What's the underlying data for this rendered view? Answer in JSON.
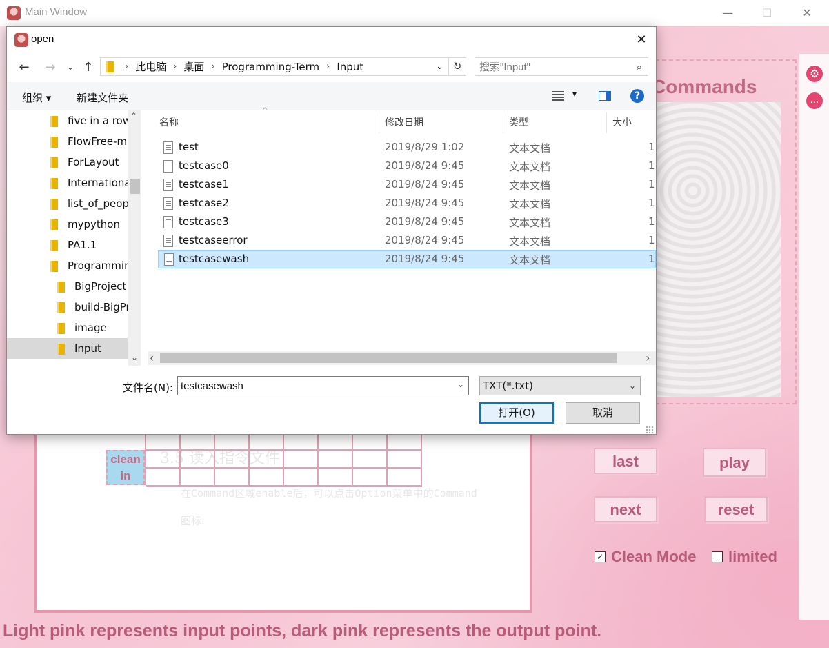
{
  "main_window": {
    "title": "Main Window",
    "controls": {
      "minimize": "—",
      "maximize": "☐",
      "close": "✕"
    },
    "commands_title": "Commands",
    "icons": {
      "settings": "gear-icon",
      "chat": "chat-bubble-icon"
    },
    "buttons": {
      "last": "last",
      "play": "play",
      "next": "next",
      "reset": "reset"
    },
    "checkboxes": [
      {
        "label": "Clean Mode",
        "checked": true,
        "mark": "✓"
      },
      {
        "label": "limited",
        "checked": false,
        "mark": ""
      }
    ],
    "clean_in_label": "clean in",
    "footer_caption": "Light pink represents input points, dark pink represents the output point.",
    "colors": {
      "accent": "#b85c79",
      "border_pink": "#e598ad",
      "clean_in_fill": "#a9d9ee"
    }
  },
  "dialog": {
    "title": "open",
    "close": "✕",
    "nav": {
      "back": "←",
      "forward": "→",
      "recent": "⌄",
      "up": "↑"
    },
    "breadcrumb": [
      "此电脑",
      "桌面",
      "Programming-Term",
      "Input"
    ],
    "address_dropdown": "⌄",
    "refresh": "↻",
    "search_placeholder": "搜索\"Input\"",
    "toolbar": {
      "organize": "组织 ▾",
      "new_folder": "新建文件夹",
      "view_dropdown": "▾",
      "help": "?"
    },
    "tree": [
      "five in a row",
      "FlowFree-ma",
      "ForLayout",
      "Internationa",
      "list_of_peop",
      "mypython",
      "PA1.1",
      "Programmin",
      "BigProject",
      "build-BigPr",
      "image",
      "Input"
    ],
    "columns": {
      "name": "名称",
      "date": "修改日期",
      "type": "类型",
      "size": "大小"
    },
    "files": [
      {
        "name": "test",
        "date": "2019/8/29 1:02",
        "type": "文本文档",
        "size": "1"
      },
      {
        "name": "testcase0",
        "date": "2019/8/24 9:45",
        "type": "文本文档",
        "size": "1"
      },
      {
        "name": "testcase1",
        "date": "2019/8/24 9:45",
        "type": "文本文档",
        "size": "1"
      },
      {
        "name": "testcase2",
        "date": "2019/8/24 9:45",
        "type": "文本文档",
        "size": "1"
      },
      {
        "name": "testcase3",
        "date": "2019/8/24 9:45",
        "type": "文本文档",
        "size": "1"
      },
      {
        "name": "testcaseerror",
        "date": "2019/8/24 9:45",
        "type": "文本文档",
        "size": "1"
      },
      {
        "name": "testcasewash",
        "date": "2019/8/24 9:45",
        "type": "文本文档",
        "size": "1"
      }
    ],
    "filename_label": "文件名(N):",
    "filename_value": "testcasewash",
    "filetype": "TXT(*.txt)",
    "open_button": "打开(O)",
    "cancel_button": "取消",
    "scroll_arrows": {
      "up": "⌃",
      "down": "⌄",
      "left": "‹",
      "right": "›"
    }
  }
}
